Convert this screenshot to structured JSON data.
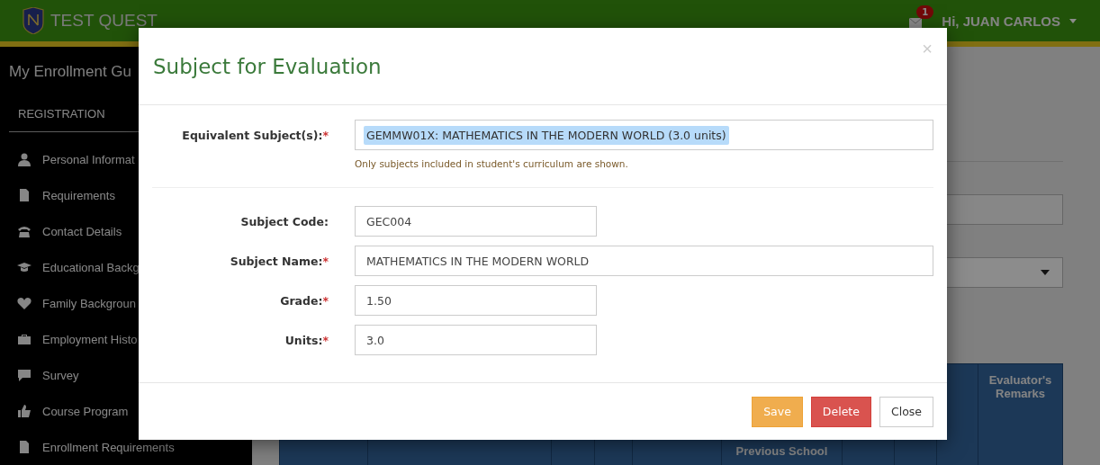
{
  "header": {
    "brand": "TEST QUEST",
    "mail_count": "1",
    "user": "Hi, JUAN CARLOS"
  },
  "sidebar": {
    "title": "My Enrollment Gu",
    "section": "REGISTRATION",
    "items": [
      {
        "label": "Personal Informat"
      },
      {
        "label": "Requirements"
      },
      {
        "label": "Contact Details"
      },
      {
        "label": "Educational Backg"
      },
      {
        "label": "Family Backgroun"
      },
      {
        "label": "Employment Histo"
      },
      {
        "label": "Survey"
      },
      {
        "label": "Course Program"
      },
      {
        "label": "Enrollment Requirements"
      }
    ]
  },
  "table": {
    "columns": [
      "",
      "",
      "",
      "",
      "",
      "Previous School",
      "",
      "",
      "",
      "Evaluator's Remarks"
    ]
  },
  "modal": {
    "title": "Subject for Evaluation",
    "close": "×",
    "required_marker": "*",
    "equivalent": {
      "label": "Equivalent Subject(s):",
      "required": true,
      "value": "GEMMW01X: MATHEMATICS IN THE MODERN WORLD (3.0 units)",
      "help": "Only subjects included in student's curriculum are shown."
    },
    "fields": [
      {
        "label": "Subject Code:",
        "required": false,
        "value": "GEC004"
      },
      {
        "label": "Subject Name:",
        "required": true,
        "value": "MATHEMATICS IN THE MODERN WORLD"
      },
      {
        "label": "Grade:",
        "required": true,
        "value": "1.50"
      },
      {
        "label": "Units:",
        "required": true,
        "value": "3.0"
      }
    ],
    "buttons": [
      {
        "label": "Save",
        "kind": "warning"
      },
      {
        "label": "Delete",
        "kind": "danger"
      },
      {
        "label": "Close",
        "kind": "default"
      }
    ]
  }
}
